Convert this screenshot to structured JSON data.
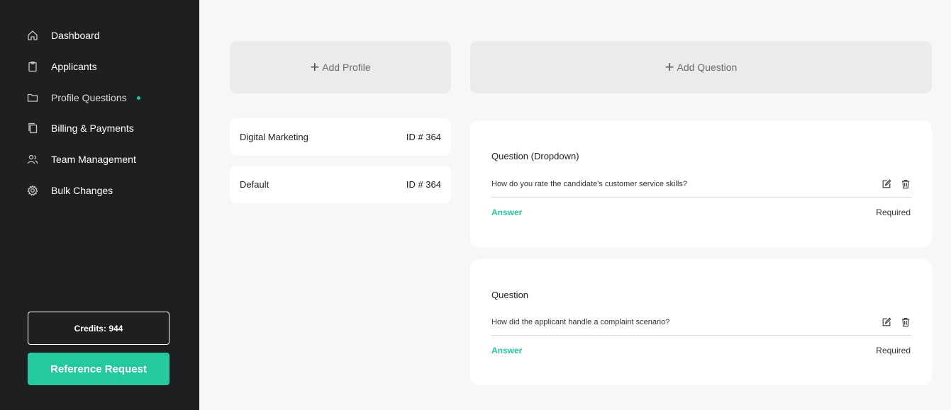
{
  "sidebar": {
    "items": [
      {
        "label": "Dashboard",
        "icon": "home-icon"
      },
      {
        "label": "Applicants",
        "icon": "clipboard-icon"
      },
      {
        "label": "Profile Questions",
        "icon": "folder-icon",
        "active": true
      },
      {
        "label": "Billing & Payments",
        "icon": "copy-icon"
      },
      {
        "label": "Team Management",
        "icon": "users-icon"
      },
      {
        "label": "Bulk Changes",
        "icon": "gear-icon"
      }
    ],
    "credits_label": "Credits: 944",
    "reference_button": "Reference Request"
  },
  "actions": {
    "add_profile": "Add Profile",
    "add_question": "Add Question"
  },
  "profiles": [
    {
      "name": "Digital Marketing",
      "id": "ID # 364"
    },
    {
      "name": "Default",
      "id": "ID # 364"
    }
  ],
  "questions": [
    {
      "type": "Question (Dropdown)",
      "text": "How do you rate the candidate's customer service skills?",
      "answer_label": "Answer",
      "required_label": "Required"
    },
    {
      "type": "Question",
      "text": "How did the applicant handle a complaint scenario?",
      "answer_label": "Answer",
      "required_label": "Required"
    }
  ],
  "colors": {
    "accent": "#25c9a0",
    "sidebar_bg": "#1e1f21",
    "page_bg": "#f6f7f9"
  }
}
